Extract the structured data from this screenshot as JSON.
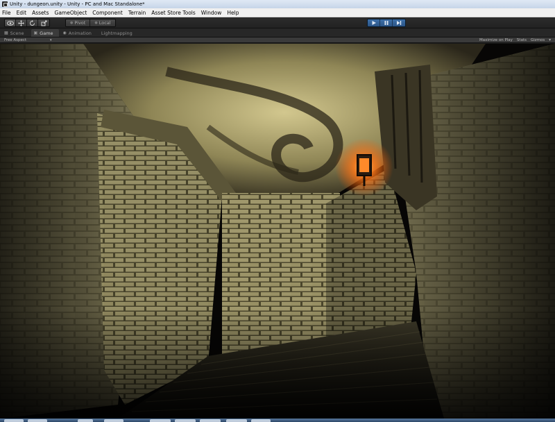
{
  "window": {
    "title": "Unity - dungeon.unity - Unity - PC and Mac Standalone*"
  },
  "menubar": {
    "items": [
      {
        "label": "File"
      },
      {
        "label": "Edit"
      },
      {
        "label": "Assets"
      },
      {
        "label": "GameObject"
      },
      {
        "label": "Component"
      },
      {
        "label": "Terrain"
      },
      {
        "label": "Asset Store Tools"
      },
      {
        "label": "Window"
      },
      {
        "label": "Help"
      }
    ]
  },
  "toolbar": {
    "transform_tools": [
      {
        "icon": "eye-icon"
      },
      {
        "icon": "move-icon"
      },
      {
        "icon": "rotate-icon"
      },
      {
        "icon": "scale-icon"
      }
    ],
    "pivot_label": "Pivot",
    "local_label": "Local",
    "playback": [
      {
        "icon": "play-icon"
      },
      {
        "icon": "pause-icon"
      },
      {
        "icon": "step-icon"
      }
    ],
    "playback_color": "#3d6fa8"
  },
  "tabs": [
    {
      "label": "Scene",
      "icon": "grid-icon",
      "active": false
    },
    {
      "label": "Game",
      "icon": "game-icon",
      "active": true
    },
    {
      "label": "Animation",
      "icon": "animation-icon",
      "active": false
    },
    {
      "label": "Lightmapping",
      "icon": "",
      "active": false
    }
  ],
  "gameview": {
    "aspect_label": "Free Aspect",
    "maximize_label": "Maximize on Play",
    "stats_label": "Stats",
    "gizmos_label": "Gizmos"
  },
  "scene": {
    "description_colors": {
      "stone": "#8a8460",
      "light_wall": "#c9c08a",
      "shadow": "#0a0806",
      "torch": "#ff7a1a"
    }
  }
}
